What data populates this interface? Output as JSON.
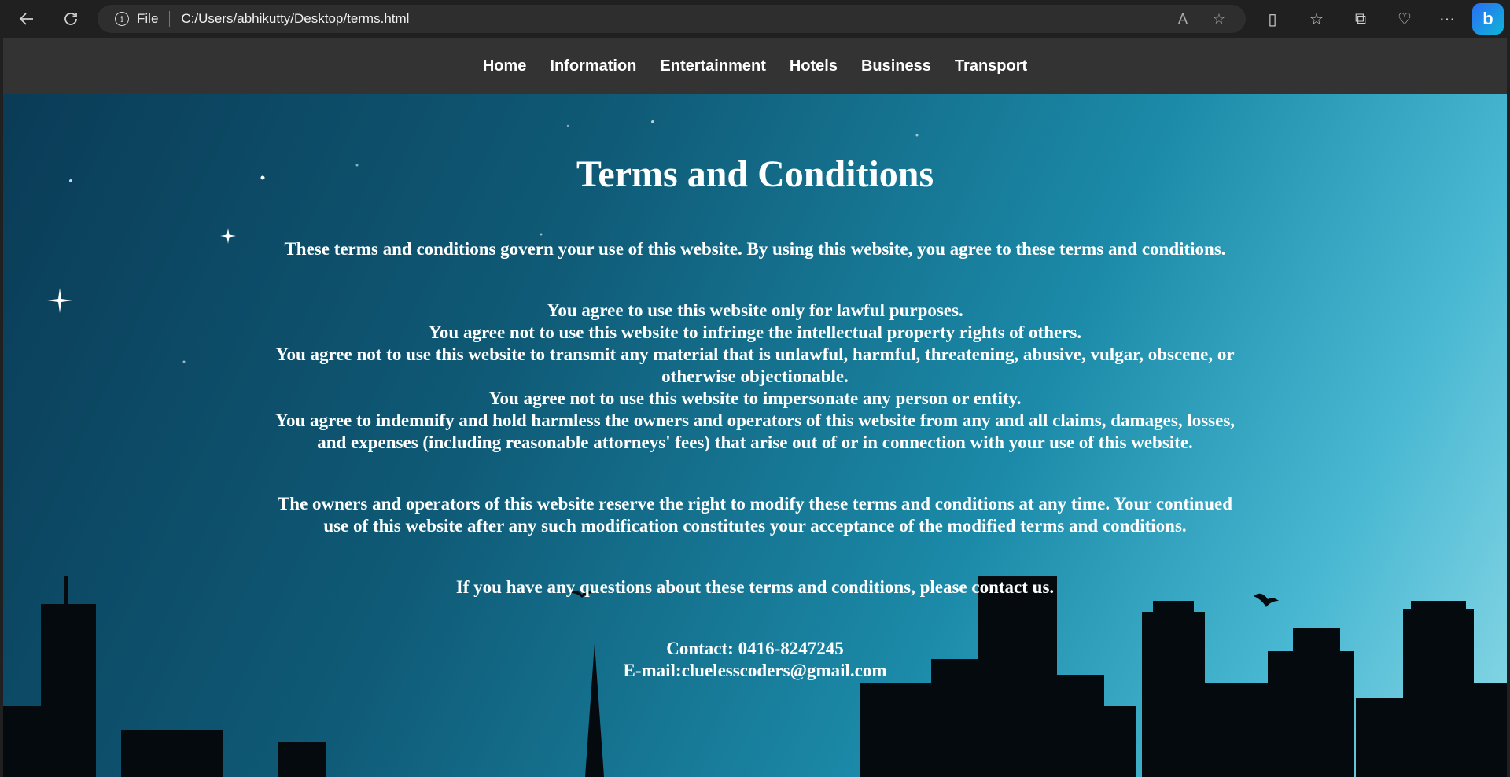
{
  "browser": {
    "address_scheme": "File",
    "address_url": "C:/Users/abhikutty/Desktop/terms.html",
    "icons": [
      "back-icon",
      "refresh-icon",
      "info-icon",
      "read-aloud-icon",
      "favorite-star-icon",
      "split-screen-icon",
      "favorites-icon",
      "collections-icon",
      "health-icon",
      "more-icon",
      "bing-copilot-icon"
    ]
  },
  "nav": {
    "items": [
      "Home",
      "Information",
      "Entertainment",
      "Hotels",
      "Business",
      "Transport"
    ]
  },
  "page": {
    "title": "Terms and Conditions",
    "intro": "These terms and conditions govern your use of this website. By using this website, you agree to these terms and conditions.",
    "rules": [
      "You agree to use this website only for lawful purposes.",
      "You agree not to use this website to infringe the intellectual property rights of others.",
      "You agree not to use this website to transmit any material that is unlawful, harmful, threatening, abusive, vulgar, obscene, or otherwise objectionable.",
      "You agree not to use this website to impersonate any person or entity.",
      "You agree to indemnify and hold harmless the owners and operators of this website from any and all claims, damages, losses, and expenses (including reasonable attorneys' fees) that arise out of or in connection with your use of this website."
    ],
    "modification": "The owners and operators of this website reserve the right to modify these terms and conditions at any time. Your continued use of this website after any such modification constitutes your acceptance of the modified terms and conditions.",
    "questions": "If you have any questions about these terms and conditions, please contact us.",
    "contact": "Contact: 0416-8247245",
    "email": "E-mail:cluelesscoders@gmail.com"
  },
  "colors": {
    "chrome_bg": "#202020",
    "navbar_bg": "#333333",
    "text": "#ffffff"
  }
}
